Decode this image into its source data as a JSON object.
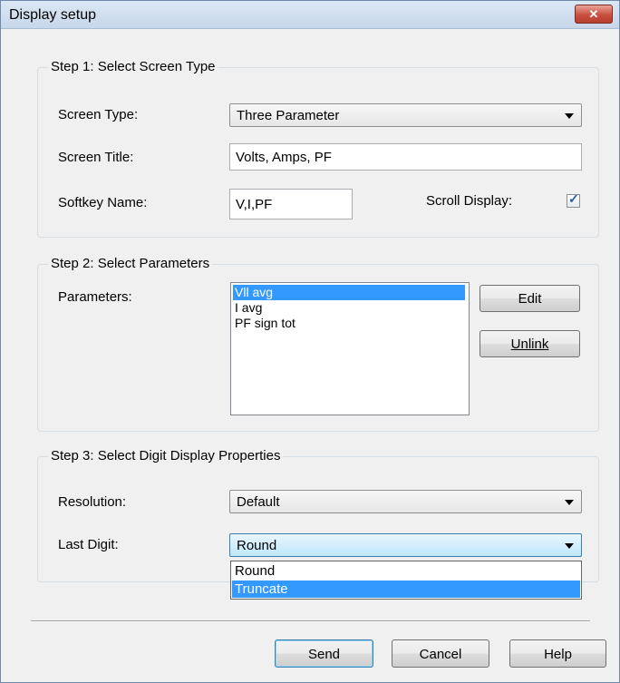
{
  "window": {
    "title": "Display setup",
    "close_glyph": "✕"
  },
  "step1": {
    "legend": "Step 1: Select Screen Type",
    "screen_type_label": "Screen Type:",
    "screen_type_value": "Three Parameter",
    "screen_title_label": "Screen Title:",
    "screen_title_value": "Volts, Amps, PF",
    "softkey_label": "Softkey Name:",
    "softkey_value": "V,I,PF",
    "scroll_label": "Scroll Display:",
    "scroll_checked": true
  },
  "step2": {
    "legend": "Step 2: Select Parameters",
    "parameters_label": "Parameters:",
    "parameters": [
      "Vll avg",
      "I avg",
      "PF sign tot"
    ],
    "selected_index": 0,
    "edit_label": "Edit",
    "unlink_label": "Unlink"
  },
  "step3": {
    "legend": "Step 3: Select Digit Display Properties",
    "resolution_label": "Resolution:",
    "resolution_value": "Default",
    "last_digit_label": "Last Digit:",
    "last_digit_value": "Round",
    "last_digit_options": [
      "Round",
      "Truncate"
    ],
    "highlighted_option": "Truncate"
  },
  "footer": {
    "send_label": "Send",
    "cancel_label": "Cancel",
    "help_label": "Help"
  },
  "colors": {
    "selection": "#3399ff",
    "close_button": "#c9503f",
    "focus_border": "#3c7fb1"
  }
}
